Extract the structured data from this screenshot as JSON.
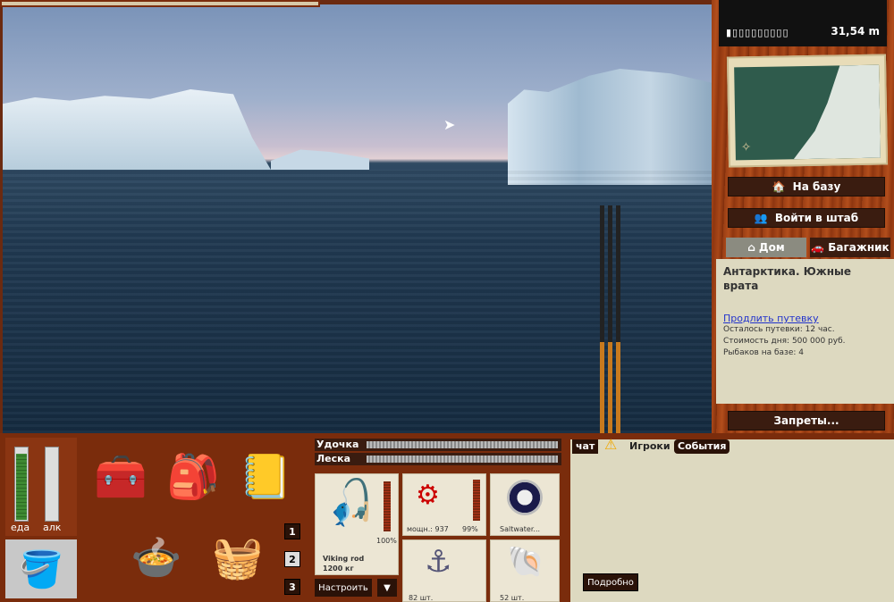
{
  "hud": {
    "distance": "31,54 m",
    "signal": "▮▯▯▯▯▯▯▯▯▯"
  },
  "location": {
    "title": "Антарктика. Южные врата",
    "extend_link": "Продлить путевку",
    "time_left": "Осталось путевки: 12 час.",
    "day_cost": "Стоимость дня: 500 000 руб.",
    "fishers": "Рыбаков на базе: 4"
  },
  "buttons": {
    "to_base": "На базу",
    "hq": "Войти в штаб",
    "bans": "Запреты...",
    "configure": "Настроить",
    "details": "Подробно"
  },
  "tabs": {
    "home": "Дом",
    "trunk": "Багажник"
  },
  "meters": {
    "food_label": "еда",
    "alc_label": "алк",
    "food_level": 0.9,
    "alc_level": 0
  },
  "slots": [
    "1",
    "2",
    "3"
  ],
  "tension": {
    "rod": "Удочка",
    "line": "Леска"
  },
  "tackle": {
    "rod_name": "Viking rod",
    "rod_cap": "1200 кг",
    "rod_pct": "100%",
    "reel_power": "мощн.: 937",
    "reel_pct": "99%",
    "line_name": "Saltwater...",
    "hooks_count": "82 шт.",
    "bait_count": "52 шт."
  },
  "chat_tabs": {
    "chat": "чат",
    "players": "Игроки",
    "events": "События"
  },
  "colors": {
    "panel": "#ddd9c0",
    "button": "#3a1c10",
    "wood": "#a84718"
  }
}
